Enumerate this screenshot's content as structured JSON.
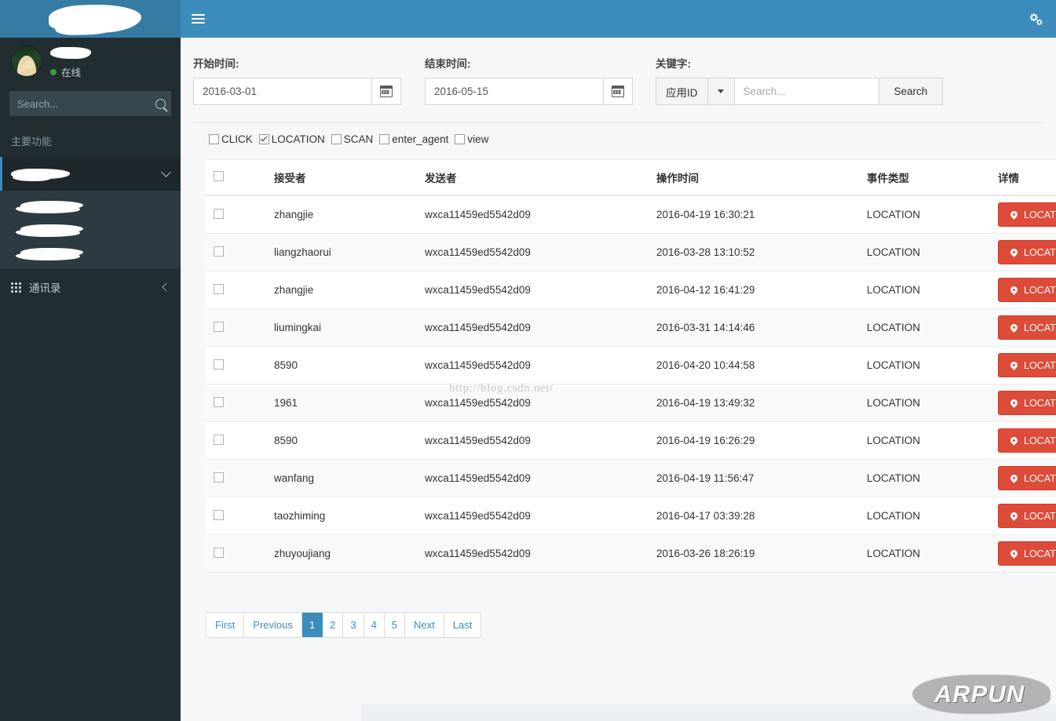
{
  "app": {
    "brand_redacted": true,
    "topbar": {
      "menu_toggle_icon": "hamburger-icon",
      "settings_icon": "cogs-icon"
    }
  },
  "sidebar": {
    "user": {
      "name_redacted": true,
      "status_label": "在线",
      "status_color": "#3c9c3c",
      "avatar_icon": "user-avatar-photo"
    },
    "search": {
      "placeholder": "Search...",
      "value": "",
      "icon": "search-icon"
    },
    "heading": "主要功能",
    "items": [
      {
        "label_redacted": true,
        "active": true,
        "expand_icon": "chevron-down-icon"
      },
      {
        "label_redacted": true,
        "sub": true
      },
      {
        "label_redacted": true,
        "sub": true
      },
      {
        "label_redacted": true,
        "sub": true
      }
    ],
    "contacts": {
      "label": "通讯录",
      "icon": "grid-icon",
      "collapse_icon": "chevron-left-icon"
    }
  },
  "filters": {
    "start_time": {
      "label": "开始时间:",
      "value": "2016-03-01",
      "calendar_icon": "calendar-icon"
    },
    "end_time": {
      "label": "结束时间:",
      "value": "2016-05-15",
      "calendar_icon": "calendar-icon"
    },
    "keyword": {
      "label": "关键字:",
      "select_value": "应用ID",
      "caret_icon": "caret-down-icon",
      "input_placeholder": "Search...",
      "input_value": "",
      "search_button": "Search"
    },
    "event_types": [
      {
        "label": "CLICK",
        "checked": false
      },
      {
        "label": "LOCATION",
        "checked": true
      },
      {
        "label": "SCAN",
        "checked": false
      },
      {
        "label": "enter_agent",
        "checked": false
      },
      {
        "label": "view",
        "checked": false
      }
    ]
  },
  "table": {
    "select_all_checked": false,
    "columns": [
      "接受者",
      "发送者",
      "操作时间",
      "事件类型",
      "详情"
    ],
    "detail_button_label": "LOCATION",
    "detail_button_icon": "map-marker-icon",
    "detail_button_color": "#dd4b39",
    "rows": [
      {
        "receiver": "zhangjie",
        "sender": "wxca11459ed5542d09",
        "time": "2016-04-19 16:30:21",
        "event": "LOCATION",
        "detail": "LOCATION"
      },
      {
        "receiver": "liangzhaorui",
        "sender": "wxca11459ed5542d09",
        "time": "2016-03-28 13:10:52",
        "event": "LOCATION",
        "detail": "LOCATION"
      },
      {
        "receiver": "zhangjie",
        "sender": "wxca11459ed5542d09",
        "time": "2016-04-12 16:41:29",
        "event": "LOCATION",
        "detail": "LOCATION"
      },
      {
        "receiver": "liumingkai",
        "sender": "wxca11459ed5542d09",
        "time": "2016-03-31 14:14:46",
        "event": "LOCATION",
        "detail": "LOCATION"
      },
      {
        "receiver": "8590",
        "sender": "wxca11459ed5542d09",
        "time": "2016-04-20 10:44:58",
        "event": "LOCATION",
        "detail": "LOCATION"
      },
      {
        "receiver": "1961",
        "sender": "wxca11459ed5542d09",
        "time": "2016-04-19 13:49:32",
        "event": "LOCATION",
        "detail": "LOCATION"
      },
      {
        "receiver": "8590",
        "sender": "wxca11459ed5542d09",
        "time": "2016-04-19 16:26:29",
        "event": "LOCATION",
        "detail": "LOCATION"
      },
      {
        "receiver": "wanfang",
        "sender": "wxca11459ed5542d09",
        "time": "2016-04-19 11:56:47",
        "event": "LOCATION",
        "detail": "LOCATION"
      },
      {
        "receiver": "taozhiming",
        "sender": "wxca11459ed5542d09",
        "time": "2016-04-17 03:39:28",
        "event": "LOCATION",
        "detail": "LOCATION"
      },
      {
        "receiver": "zhuyoujiang",
        "sender": "wxca11459ed5542d09",
        "time": "2016-03-26 18:26:19",
        "event": "LOCATION",
        "detail": "LOCATION"
      }
    ]
  },
  "pagination": {
    "first": "First",
    "previous": "Previous",
    "pages": [
      "1",
      "2",
      "3",
      "4",
      "5"
    ],
    "active_page": "1",
    "next": "Next",
    "last": "Last"
  },
  "watermarks": {
    "url": "http://blog.csdn.net/",
    "logo": "ARPUN"
  },
  "colors": {
    "header_blue": "#3c8dbc",
    "sidebar_dark": "#222d32",
    "submenu_bg": "#2c3b41",
    "accent_red": "#dd4b39",
    "content_bg": "#f6f7f9"
  }
}
